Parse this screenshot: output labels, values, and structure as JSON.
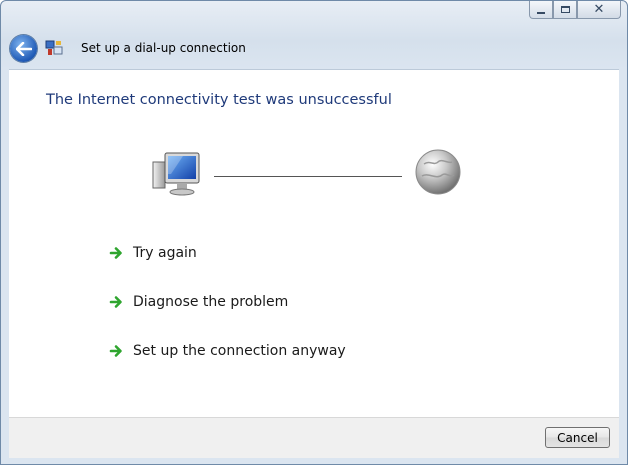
{
  "window": {
    "title": "Set up a dial-up connection",
    "caption_buttons": {
      "minimize": "minimize-icon",
      "maximize": "maximize-icon",
      "close": "close-icon"
    }
  },
  "content": {
    "heading": "The Internet connectivity test was unsuccessful",
    "options": [
      {
        "label": "Try again",
        "icon": "green-arrow-icon"
      },
      {
        "label": "Diagnose the problem",
        "icon": "green-arrow-icon"
      },
      {
        "label": "Set up the connection anyway",
        "icon": "green-arrow-icon"
      }
    ]
  },
  "footer": {
    "cancel_label": "Cancel"
  },
  "colors": {
    "heading": "#1f3a7a",
    "arrow": "#2fa52f",
    "back_button": "#1f5ab6"
  }
}
